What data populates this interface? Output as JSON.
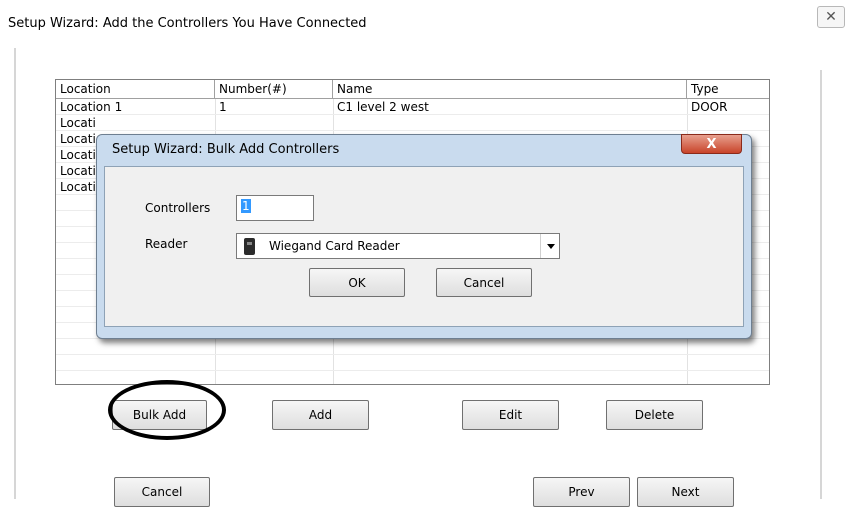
{
  "window": {
    "title": "Setup Wizard: Add the Controllers You Have Connected",
    "close_glyph": "✕"
  },
  "grid": {
    "columns": [
      "Location",
      "Number(#)",
      "Name",
      "Type"
    ],
    "rows": [
      {
        "location": "Location 1",
        "number": "1",
        "name": "C1 level 2 west",
        "type": "DOOR"
      },
      {
        "location": "Locati",
        "number": "",
        "name": "",
        "type": ""
      },
      {
        "location": "Locati",
        "number": "",
        "name": "",
        "type": ""
      },
      {
        "location": "Locati",
        "number": "",
        "name": "",
        "type": ""
      },
      {
        "location": "Locati",
        "number": "",
        "name": "",
        "type": ""
      },
      {
        "location": "Locati",
        "number": "",
        "name": "",
        "type": ""
      }
    ]
  },
  "buttons": {
    "bulk_add": "Bulk Add",
    "add": "Add",
    "edit": "Edit",
    "delete": "Delete",
    "cancel": "Cancel",
    "prev": "Prev",
    "next": "Next"
  },
  "dialog": {
    "title": "Setup Wizard: Bulk Add Controllers",
    "close_glyph": "X",
    "controllers_label": "Controllers",
    "controllers_value": "1",
    "reader_label": "Reader",
    "reader_value": "Wiegand Card Reader",
    "ok": "OK",
    "cancel": "Cancel"
  },
  "colors": {
    "dialog_frame": "#c9dbee",
    "close_red": "#c8442a",
    "selection": "#3399ff"
  }
}
